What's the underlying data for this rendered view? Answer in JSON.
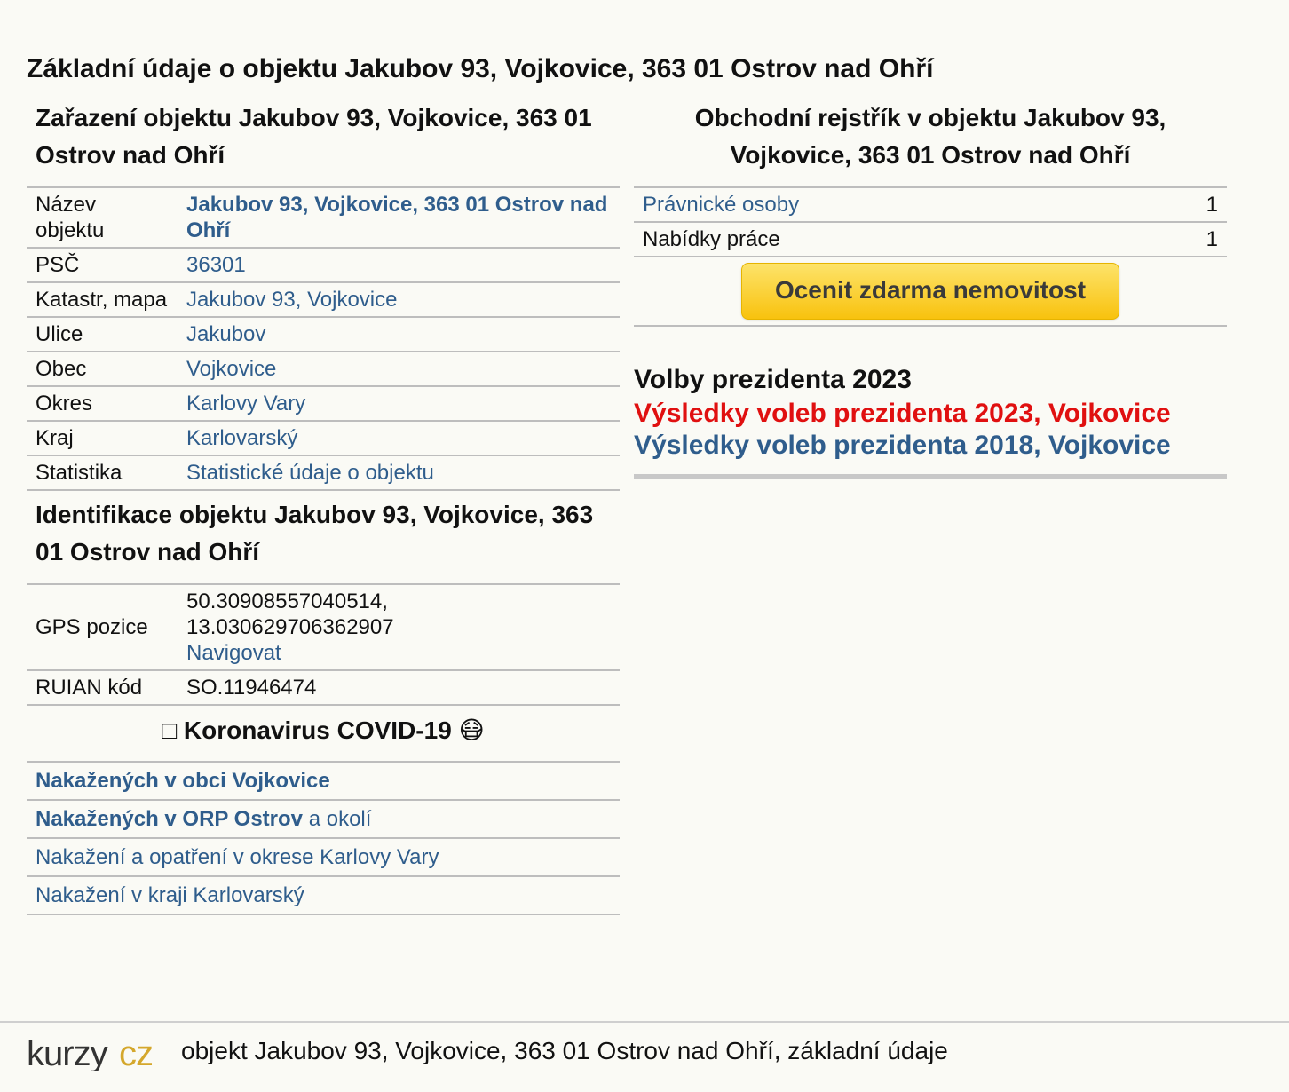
{
  "page_title": "Základní údaje o objektu Jakubov 93, Vojkovice, 363 01 Ostrov nad Ohří",
  "classification": {
    "title": "Zařazení objektu Jakubov 93, Vojkovice, 363 01 Ostrov nad Ohří",
    "rows": [
      {
        "key": "Název objektu",
        "value": "Jakubov 93, Vojkovice, 363 01 Ostrov nad Ohří"
      },
      {
        "key": "PSČ",
        "value": "36301"
      },
      {
        "key": "Katastr, mapa",
        "value": "Jakubov 93, Vojkovice"
      },
      {
        "key": "Ulice",
        "value": "Jakubov"
      },
      {
        "key": "Obec",
        "value": "Vojkovice"
      },
      {
        "key": "Okres",
        "value": "Karlovy Vary"
      },
      {
        "key": "Kraj",
        "value": "Karlovarský"
      },
      {
        "key": "Statistika",
        "value": "Statistické údaje o objektu"
      }
    ]
  },
  "identification": {
    "title": "Identifikace objektu Jakubov 93, Vojkovice, 363 01 Ostrov nad Ohří",
    "gps_label": "GPS pozice",
    "gps_lat": "50.30908557040514,",
    "gps_lon": "13.030629706362907",
    "navigate": "Navigovat",
    "ruian_label": "RUIAN kód",
    "ruian_value": "SO.11946474"
  },
  "covid": {
    "prefix_icon": "□",
    "title": "Koronavirus COVID-19",
    "suffix_icon": "😷",
    "links": [
      {
        "bold": "Nakažených v obci Vojkovice",
        "rest": ""
      },
      {
        "bold": "Nakažených v ORP Ostrov",
        "rest": " a okolí"
      },
      {
        "bold": "",
        "rest": "Nakažení a opatření v okrese Karlovy Vary"
      },
      {
        "bold": "",
        "rest": "Nakažení v kraji Karlovarský"
      }
    ]
  },
  "registry": {
    "title": "Obchodní rejstřík v objektu Jakubov 93, Vojkovice, 363 01 Ostrov nad Ohří",
    "rows": [
      {
        "label": "Právnické osoby",
        "count": "1"
      },
      {
        "label": "Nabídky práce",
        "count": "1"
      }
    ],
    "button": "Ocenit zdarma nemovitost"
  },
  "elections": {
    "title": "Volby prezidenta 2023",
    "link_2023": "Výsledky voleb prezidenta 2023, Vojkovice",
    "link_2018": "Výsledky voleb prezidenta 2018, Vojkovice"
  },
  "footer": {
    "logo_text": "kurzy",
    "logo_suffix": "cz",
    "text": "objekt Jakubov 93, Vojkovice, 363 01 Ostrov nad Ohří, základní údaje"
  },
  "colors": {
    "link": "#2f5d8c",
    "highlight": "#e01010",
    "button": "#f8c20e",
    "logo_accent": "#d4a72c"
  }
}
